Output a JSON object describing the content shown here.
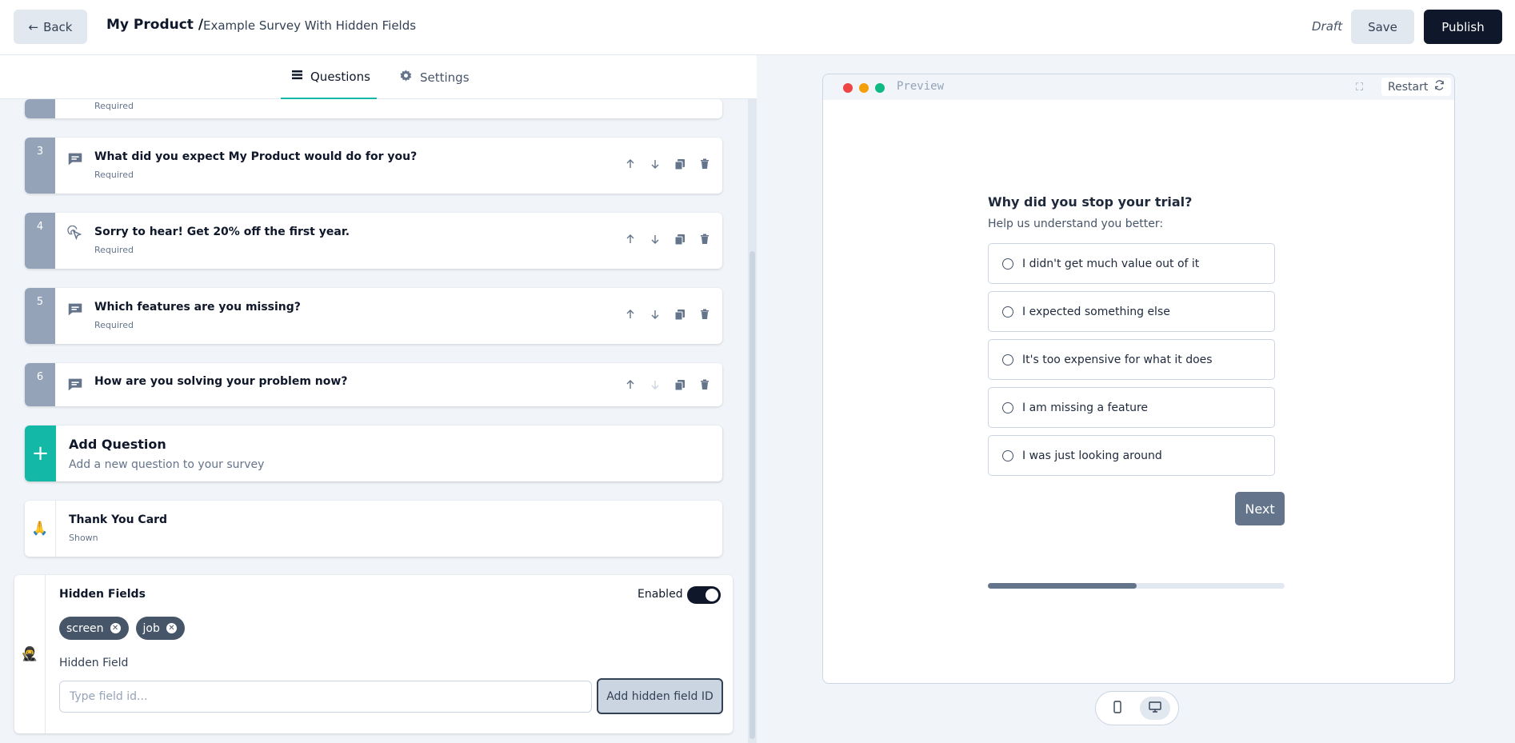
{
  "header": {
    "back_label": "Back",
    "product": "My Product /",
    "survey_name": "Example Survey With Hidden Fields",
    "status": "Draft",
    "save_label": "Save",
    "publish_label": "Publish"
  },
  "tabs": [
    {
      "label": "Questions",
      "active": true,
      "icon": "list-icon"
    },
    {
      "label": "Settings",
      "active": false,
      "icon": "gear-icon"
    }
  ],
  "questions": [
    {
      "number": "3",
      "icon": "message-icon",
      "title": "What did you expect My Product would do for you?",
      "subtitle": "Required"
    },
    {
      "number": "4",
      "icon": "cursor-click-icon",
      "title": "Sorry to hear! Get 20% off the first year.",
      "subtitle": "Required"
    },
    {
      "number": "5",
      "icon": "message-icon",
      "title": "Which features are you missing?",
      "subtitle": "Required"
    },
    {
      "number": "6",
      "icon": "message-icon",
      "title": "How are you solving your problem now?",
      "subtitle": ""
    }
  ],
  "partial_question_subtitle": "Required",
  "add_question": {
    "title": "Add Question",
    "subtitle": "Add a new question to your survey"
  },
  "thank_you": {
    "emoji": "🙏",
    "title": "Thank You Card",
    "subtitle": "Shown"
  },
  "hidden_fields": {
    "emoji": "🥷",
    "title": "Hidden Fields",
    "enabled_label": "Enabled",
    "enabled": true,
    "chips": [
      "screen",
      "job"
    ],
    "field_label": "Hidden Field",
    "input_placeholder": "Type field id...",
    "add_button": "Add hidden field ID"
  },
  "preview": {
    "window_title": "Preview",
    "restart_label": "Restart",
    "question": "Why did you stop your trial?",
    "description": "Help us understand you better:",
    "options": [
      "I didn't get much value out of it",
      "I expected something else",
      "It's too expensive for what it does",
      "I am missing a feature",
      "I was just looking around"
    ],
    "next_label": "Next",
    "progress": 0.5,
    "selected_device": "desktop"
  },
  "colors": {
    "accent": "#14b8a6",
    "primary_dark": "#0f172a",
    "question_bar": "#94a3b8"
  }
}
